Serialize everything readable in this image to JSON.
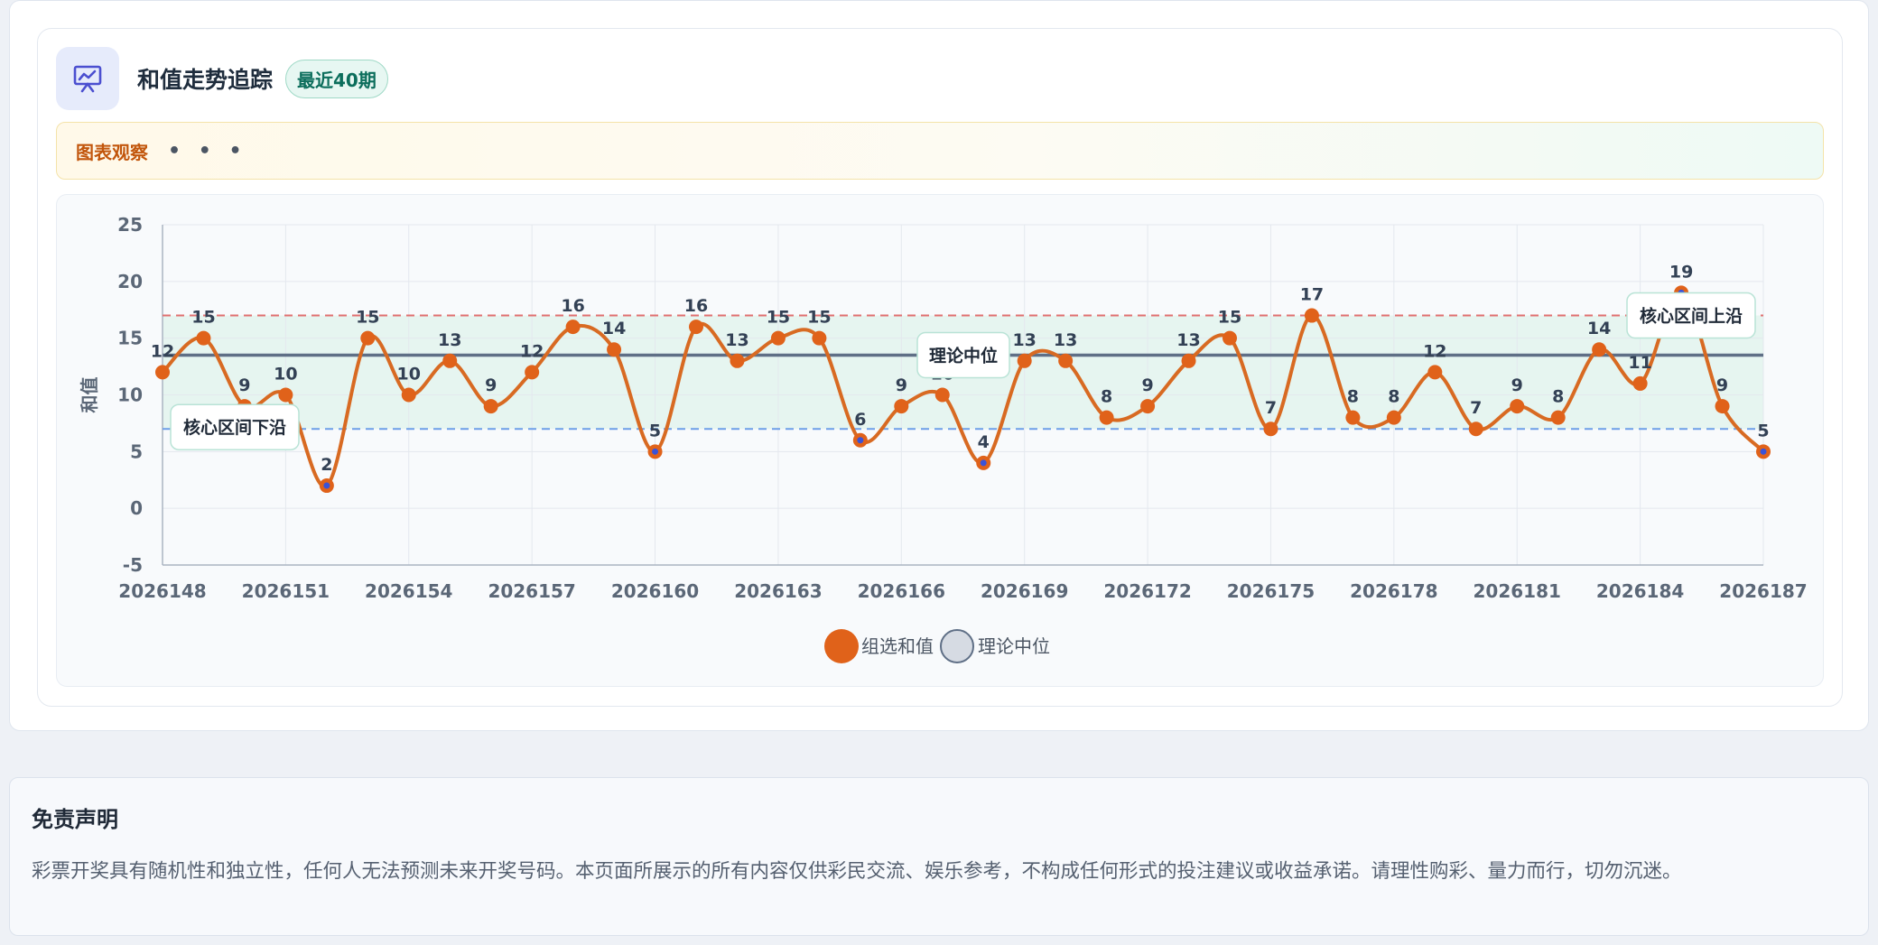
{
  "header": {
    "title": "和值走势追踪",
    "badge": "最近40期",
    "icon": "chart-presentation-icon"
  },
  "observation": {
    "label": "图表观察",
    "more": "• • •"
  },
  "chart_data": {
    "type": "line",
    "ylabel": "和值",
    "xlabel": "",
    "ylim": [
      -5,
      25
    ],
    "yticks": [
      -5,
      0,
      5,
      10,
      15,
      20,
      25
    ],
    "x_tick_labels": [
      "2026148",
      "2026151",
      "2026154",
      "2026157",
      "2026160",
      "2026163",
      "2026166",
      "2026169",
      "2026172",
      "2026175",
      "2026178",
      "2026181",
      "2026184",
      "2026187"
    ],
    "x": [
      2026148,
      2026149,
      2026150,
      2026151,
      2026152,
      2026153,
      2026154,
      2026155,
      2026156,
      2026157,
      2026158,
      2026159,
      2026160,
      2026161,
      2026162,
      2026163,
      2026164,
      2026165,
      2026166,
      2026167,
      2026168,
      2026169,
      2026170,
      2026171,
      2026172,
      2026173,
      2026174,
      2026175,
      2026176,
      2026177,
      2026178,
      2026179,
      2026180,
      2026181,
      2026182,
      2026183,
      2026184,
      2026185,
      2026186,
      2026187
    ],
    "series": [
      {
        "name": "组选和值",
        "color": "#e0621a",
        "values": [
          12,
          15,
          9,
          10,
          2,
          15,
          10,
          13,
          9,
          12,
          16,
          14,
          5,
          16,
          13,
          15,
          15,
          6,
          9,
          10,
          4,
          13,
          13,
          8,
          9,
          13,
          15,
          7,
          17,
          8,
          8,
          12,
          7,
          9,
          8,
          14,
          11,
          19,
          9,
          5
        ]
      },
      {
        "name": "理论中位",
        "color": "#5f6f86",
        "value": 13.5
      }
    ],
    "band": {
      "low": 7,
      "high": 17,
      "color": "#e6f5f0"
    },
    "reference_lines": [
      {
        "value": 17,
        "label": "核心区间上沿",
        "color": "#e07070"
      },
      {
        "value": 7,
        "label": "核心区间下沿",
        "color": "#6d9ee8"
      },
      {
        "value": 13.5,
        "label": "理论中位",
        "color": "#5f6f86"
      }
    ],
    "grid": true,
    "legend": "bottom-center",
    "legend_items": [
      "组选和值",
      "理论中位"
    ]
  },
  "disclaimer": {
    "title": "免责声明",
    "text": "彩票开奖具有随机性和独立性，任何人无法预测未来开奖号码。本页面所展示的所有内容仅供彩民交流、娱乐参考，不构成任何形式的投注建议或收益承诺。请理性购彩、量力而行，切勿沉迷。"
  }
}
